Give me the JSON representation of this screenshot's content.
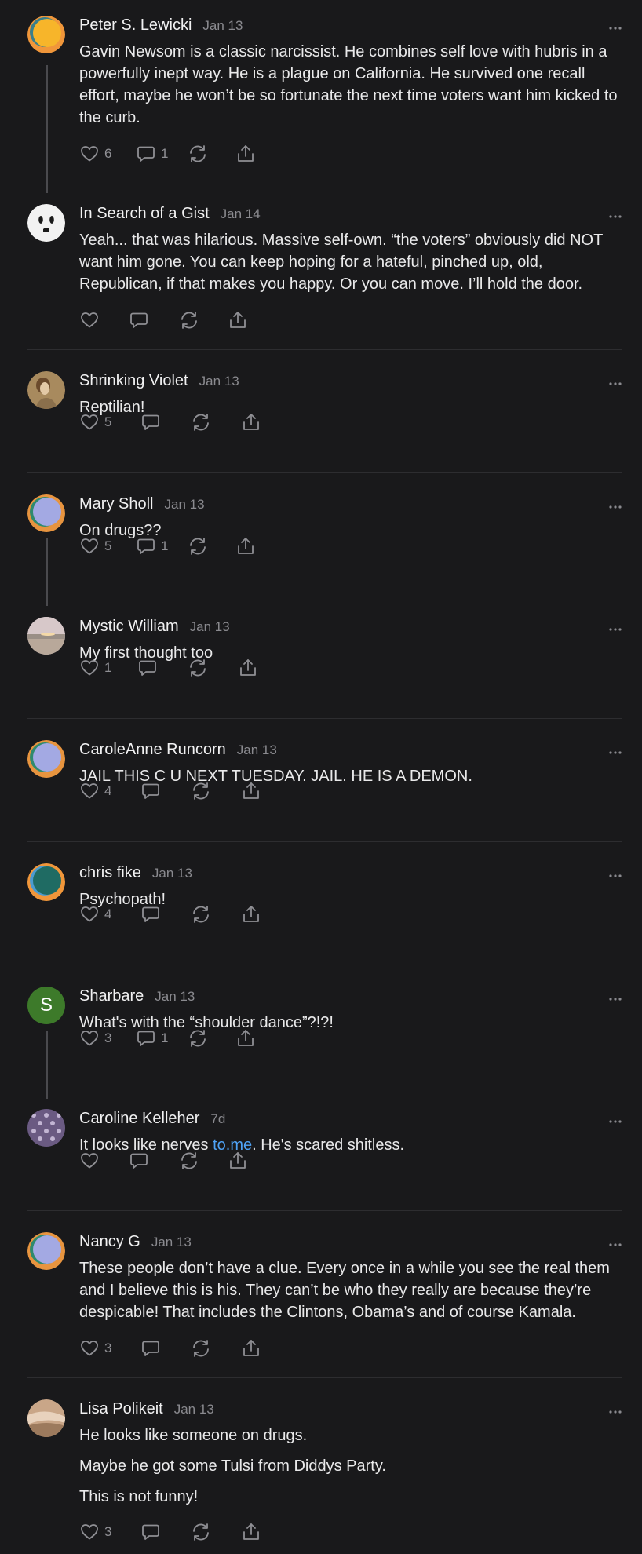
{
  "comments": [
    {
      "author": "Peter S. Lewicki",
      "date": "Jan 13",
      "avatar": "orange-blue-swirl",
      "paragraphs": [
        "Gavin Newsom is a classic narcissist. He combines self love with hubris in a powerfully inept way. He is a plague on California. He survived one recall effort, maybe he won’t be so fortunate the next time voters want him kicked to the curb."
      ],
      "likes": "6",
      "replies": "1"
    },
    {
      "author": "In Search of a Gist",
      "date": "Jan 14",
      "avatar": "electrical-outlet",
      "paragraphs": [
        "Yeah... that was hilarious. Massive self-own. “the voters” obviously did NOT want him gone. You can keep hoping for a hateful, pinched up, old, Republican, if that makes you happy. Or you can move. I’ll hold the door."
      ],
      "likes": "",
      "replies": ""
    },
    {
      "author": "Shrinking Violet",
      "date": "Jan 13",
      "avatar": "portrait-painting",
      "paragraphs": [
        "Reptilian!"
      ],
      "likes": "5",
      "replies": ""
    },
    {
      "author": "Mary Sholl",
      "date": "Jan 13",
      "avatar": "purple-orange-swirl",
      "paragraphs": [
        "On drugs??"
      ],
      "likes": "5",
      "replies": "1"
    },
    {
      "author": "Mystic William",
      "date": "Jan 13",
      "avatar": "sunset-landscape",
      "paragraphs": [
        "My first thought too"
      ],
      "likes": "1",
      "replies": ""
    },
    {
      "author": "CaroleAnne Runcorn",
      "date": "Jan 13",
      "avatar": "purple-orange-swirl",
      "paragraphs": [
        "JAIL THIS C U NEXT TUESDAY. JAIL. HE IS A DEMON."
      ],
      "likes": "4",
      "replies": ""
    },
    {
      "author": "chris fike",
      "date": "Jan 13",
      "avatar": "teal-orange-swirl",
      "paragraphs": [
        "Psychopath!"
      ],
      "likes": "4",
      "replies": ""
    },
    {
      "author": "Sharbare",
      "date": "Jan 13",
      "avatar": "letter-avatar",
      "avatar_letter": "S",
      "paragraphs": [
        "What's with the “shoulder dance”?!?!"
      ],
      "likes": "3",
      "replies": "1"
    },
    {
      "author": "Caroline Kelleher",
      "date": "7d",
      "avatar": "purple-pattern",
      "paragraph_before_link": "It looks like nerves ",
      "link_text": "to.me",
      "paragraph_after_link": ". He's scared shitless.",
      "likes": "",
      "replies": ""
    },
    {
      "author": "Nancy G",
      "date": "Jan 13",
      "avatar": "purple-orange-swirl",
      "paragraphs": [
        "These people don’t have a clue. Every once in a while you see the real them and I believe this is his. They can’t be who they really are because they’re despicable! That includes the Clintons, Obama’s and of course Kamala."
      ],
      "likes": "3",
      "replies": ""
    },
    {
      "author": "Lisa Polikeit",
      "date": "Jan 13",
      "avatar": "painted-portrait",
      "paragraphs": [
        "He looks like someone on drugs.",
        "Maybe he got some Tulsi from Diddys Party.",
        "This is not funny!"
      ],
      "likes": "3",
      "replies": ""
    }
  ],
  "icons": {
    "like": "heart-icon",
    "reply": "comment-icon",
    "restack": "restack-icon",
    "share": "share-icon",
    "more": "more-options-icon"
  },
  "colors": {
    "background": "#19191b",
    "link": "#4fa3f7",
    "letter_avatar": "#3d7a2a"
  }
}
